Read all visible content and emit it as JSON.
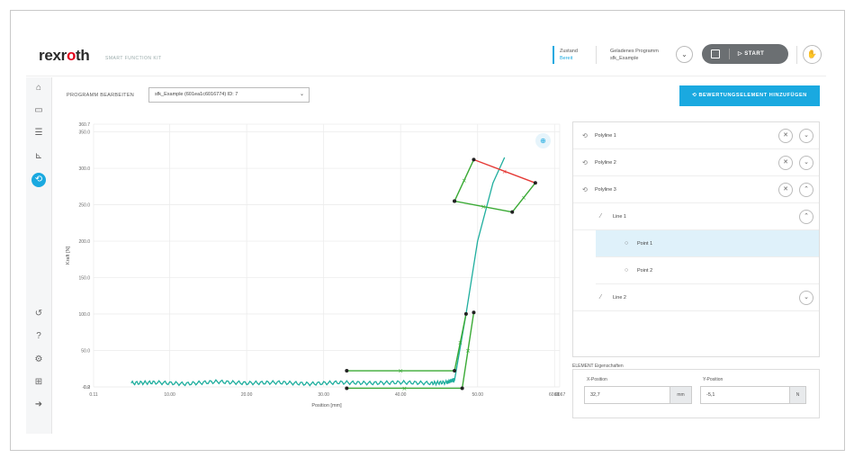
{
  "header": {
    "logo": "rexroth",
    "subtitle": "SMART FUNCTION KIT",
    "state_label": "Zustand",
    "state_value": "Bereit",
    "program_label": "Geladenes Programm",
    "program_value": "sfk_Example",
    "start_label": "START"
  },
  "toolbar": {
    "program_edit_label": "PROGRAMM BEARBEITEN",
    "program_select_value": "sfk_Example (601ea1c6016774) ID: 7",
    "add_button_label": "BEWERTUNGSELEMENT HINZUFÜGEN"
  },
  "sidebar": {
    "items": [
      {
        "icon": "home-icon",
        "glyph": "⌂"
      },
      {
        "icon": "folder-icon",
        "glyph": "▭"
      },
      {
        "icon": "steps-icon",
        "glyph": "☰"
      },
      {
        "icon": "chart-icon",
        "glyph": "⊾"
      },
      {
        "icon": "evaluation-icon",
        "glyph": "⟲"
      },
      {
        "icon": "history-icon",
        "glyph": "↺"
      },
      {
        "icon": "help-icon",
        "glyph": "?"
      },
      {
        "icon": "settings-icon",
        "glyph": "⚙"
      },
      {
        "icon": "network-icon",
        "glyph": "⊞"
      },
      {
        "icon": "logout-icon",
        "glyph": "➜"
      }
    ]
  },
  "colors": {
    "accent": "#1aa9e0",
    "curve": "#1fae9e",
    "window": "#3aaa35",
    "red": "#e53935"
  },
  "chart_data": {
    "type": "line",
    "xlabel": "Position [mm]",
    "ylabel": "Kraft [N]",
    "xlim": [
      0.11,
      60.67
    ],
    "ylim": [
      -0.2,
      360.7
    ],
    "x_ticks": [
      "0.11",
      "10.00",
      "20.00",
      "30.00",
      "40.00",
      "50.00",
      "60.00",
      "60.67"
    ],
    "y_ticks": [
      "-0.2",
      "0.0",
      "50.0",
      "100.0",
      "150.0",
      "200.0",
      "250.0",
      "300.0",
      "350.0",
      "360.7"
    ],
    "grid": true,
    "series": [
      {
        "x": [
          5,
          8,
          12,
          16,
          20,
          24,
          28,
          32,
          36,
          40,
          44,
          46,
          47,
          48.5,
          50,
          52,
          53.5
        ],
        "y": [
          5,
          6,
          4,
          7,
          5,
          6,
          4,
          6,
          5,
          6,
          5,
          6,
          10,
          100,
          200,
          280,
          315
        ]
      }
    ],
    "windows": [
      {
        "name": "Polyline 1",
        "points": [
          [
            33,
            22
          ],
          [
            47,
            22
          ],
          [
            48.5,
            100
          ]
        ]
      },
      {
        "name": "Polyline 2",
        "points": [
          [
            33,
            -2
          ],
          [
            48,
            -2
          ],
          [
            49.5,
            102
          ]
        ]
      },
      {
        "name": "Polyline 3",
        "points": [
          [
            47,
            255
          ],
          [
            49.5,
            312
          ],
          [
            57.5,
            280
          ],
          [
            54.5,
            240
          ],
          [
            47,
            255
          ]
        ]
      }
    ]
  },
  "panel": {
    "rows": [
      {
        "label": "Polyline 1",
        "level": 0,
        "expanded": false
      },
      {
        "label": "Polyline 2",
        "level": 0,
        "expanded": false
      },
      {
        "label": "Polyline 3",
        "level": 0,
        "expanded": true
      },
      {
        "label": "Line 1",
        "level": 1,
        "expanded": true
      },
      {
        "label": "Point 1",
        "level": 2,
        "selected": true
      },
      {
        "label": "Point 2",
        "level": 2
      },
      {
        "label": "Line 2",
        "level": 1,
        "expanded": false
      }
    ]
  },
  "properties": {
    "title": "ELEMENT Eigenschaften",
    "x_label": "X-Position",
    "x_value": "32,7",
    "x_unit": "mm",
    "y_label": "Y-Position",
    "y_value": "-5,1",
    "y_unit": "N"
  }
}
